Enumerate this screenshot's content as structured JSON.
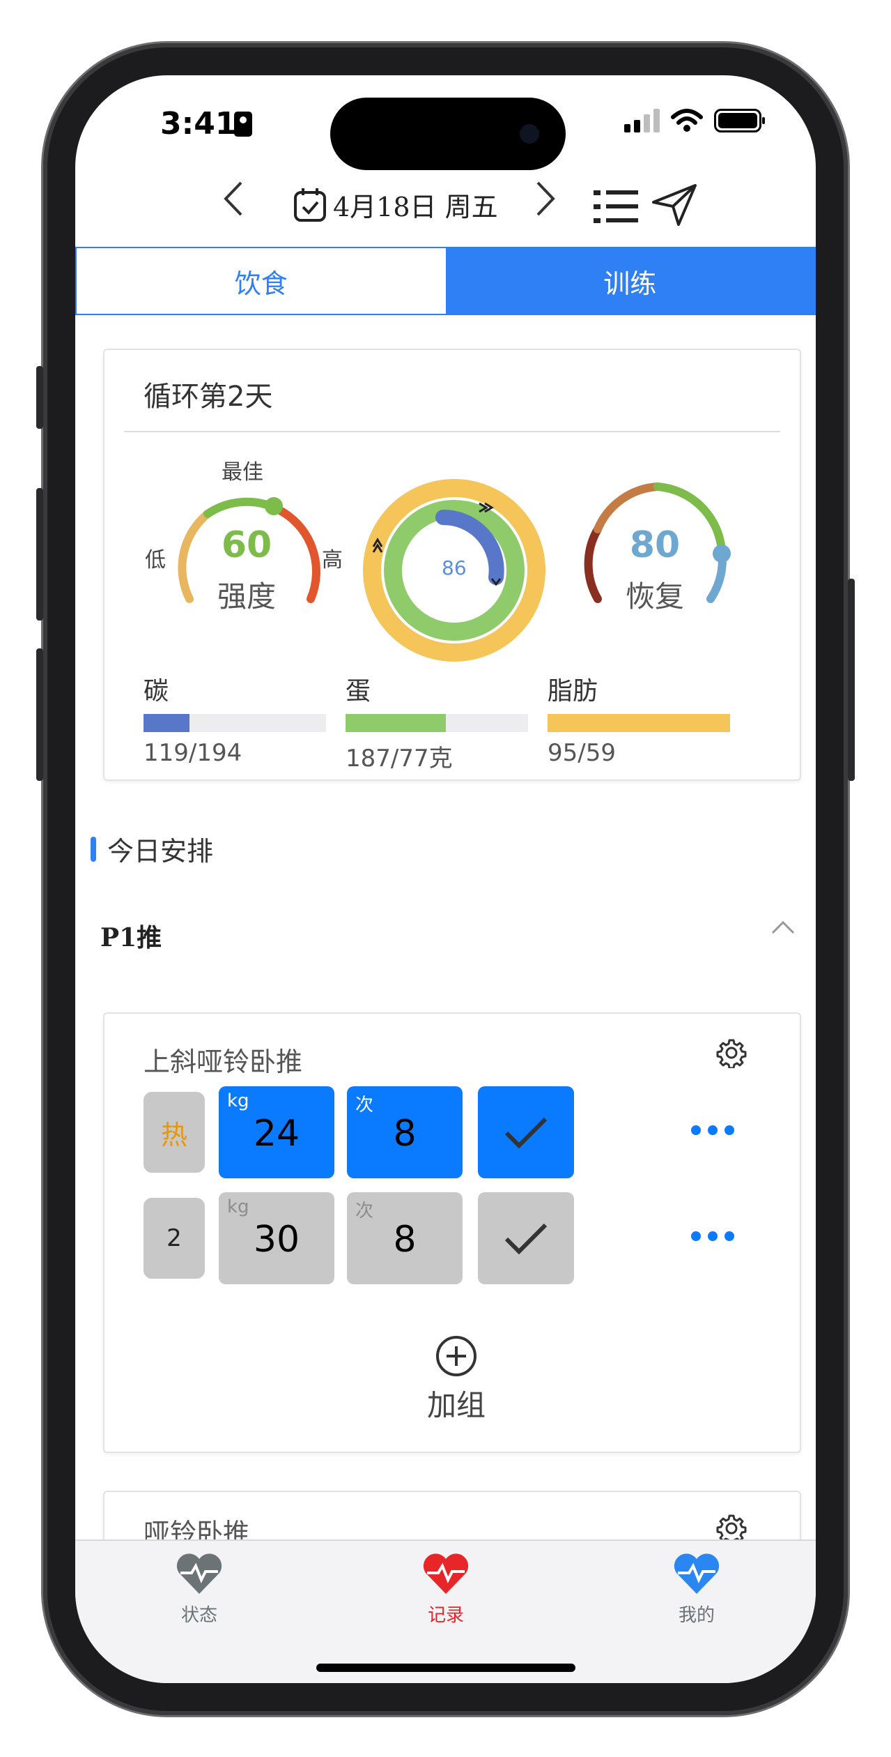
{
  "status_bar": {
    "time": "3:41"
  },
  "header": {
    "date": "4月18日 周五",
    "prev_icon": "chevron-left-icon",
    "next_icon": "chevron-right-icon",
    "calendar_icon": "calendar-check-icon",
    "list_icon": "list-icon",
    "send_icon": "send-icon"
  },
  "tabs": [
    {
      "label": "饮食",
      "active": false
    },
    {
      "label": "训练",
      "active": true
    }
  ],
  "summary": {
    "title": "循环第2天",
    "intensity": {
      "value": "60",
      "label": "强度",
      "low_label": "低",
      "high_label": "高",
      "best_label": "最佳"
    },
    "ring": {
      "value": "86"
    },
    "recovery": {
      "value": "80",
      "label": "恢复"
    },
    "macros": [
      {
        "name": "碳",
        "value": "119/194",
        "fill": 0.25,
        "color": "#5877c8"
      },
      {
        "name": "蛋",
        "value": "187/77克",
        "fill": 0.55,
        "color": "#8fcb6b"
      },
      {
        "name": "脂肪",
        "value": "95/59",
        "fill": 1.0,
        "color": "#f5c55a"
      }
    ]
  },
  "schedule": {
    "section_title": "今日安排",
    "plan_title": "P1推"
  },
  "exercise": {
    "name": "上斜哑铃卧推",
    "sets": [
      {
        "tag": "热",
        "weight": "24",
        "weight_unit": "kg",
        "reps": "8",
        "reps_unit": "次",
        "done": true
      },
      {
        "tag": "2",
        "weight": "30",
        "weight_unit": "kg",
        "reps": "8",
        "reps_unit": "次",
        "done": false
      }
    ],
    "add_label": "加组"
  },
  "exercise2": {
    "name": "哑铃卧推"
  },
  "colors": {
    "accent": "#0a7aff",
    "tab_blue": "#2f7ff5",
    "warm_tag": "#e8960c",
    "record_red": "#e8262a"
  },
  "tabbar": [
    {
      "label": "状态",
      "icon": "heart-pulse-icon",
      "color": "#6b7377"
    },
    {
      "label": "记录",
      "icon": "heart-pulse-icon",
      "color": "#e8262a"
    },
    {
      "label": "我的",
      "icon": "heart-pulse-icon",
      "color": "#2a86f0"
    }
  ]
}
